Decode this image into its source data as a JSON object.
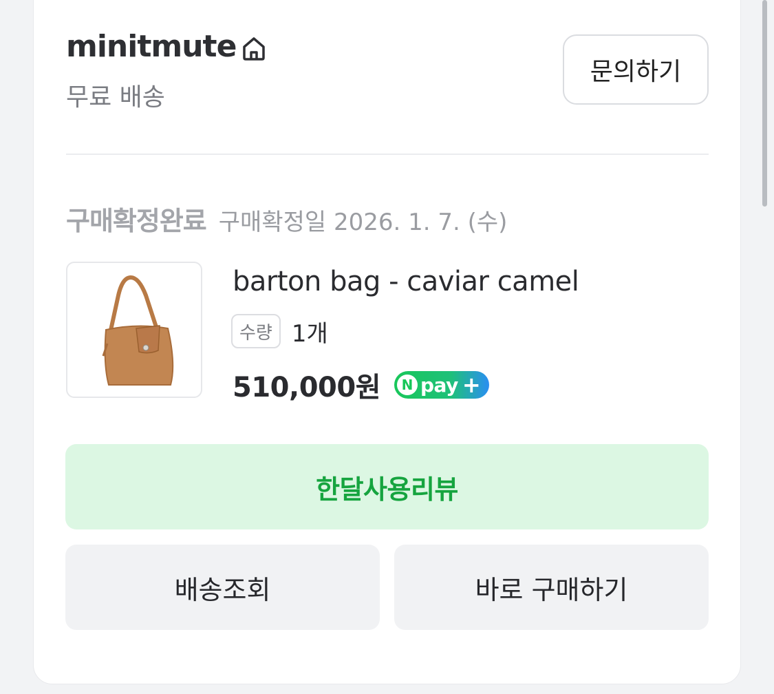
{
  "shop": {
    "name": "minitmute",
    "home_icon": "home-icon",
    "shipping_label": "무료 배송",
    "inquiry_label": "문의하기"
  },
  "order": {
    "status": "구매확정완료",
    "confirm_date": "구매확정일 2026. 1. 7. (수)"
  },
  "product": {
    "name": "barton bag - caviar camel",
    "qty_label": "수량",
    "qty_value": "1개",
    "price": "510,000원",
    "npay": {
      "n": "N",
      "text": "pay",
      "plus": "+"
    }
  },
  "actions": {
    "review": "한달사용리뷰",
    "track": "배송조회",
    "buy_again": "바로 구매하기"
  },
  "colors": {
    "accent_green": "#16a43f",
    "review_bg": "#dcf7e3"
  }
}
